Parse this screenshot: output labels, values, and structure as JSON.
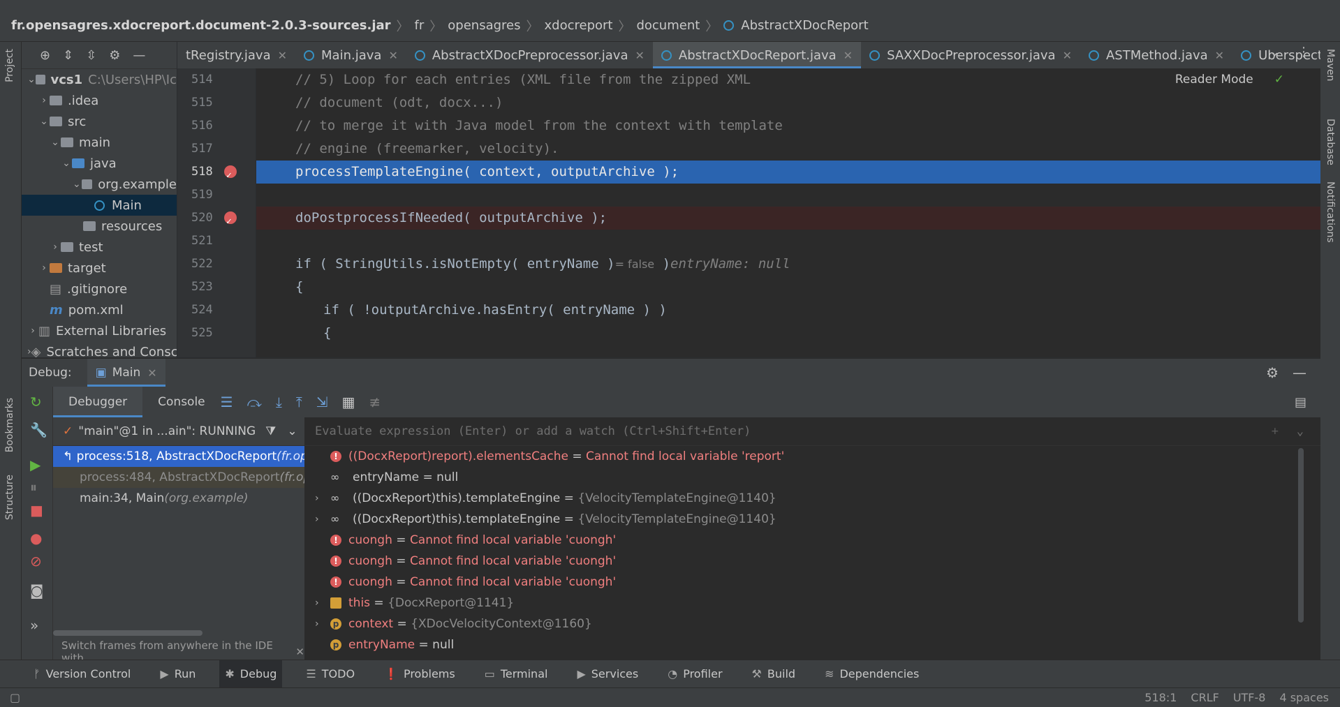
{
  "breadcrumb": {
    "items": [
      "fr.opensagres.xdocreport.document-2.0.3-sources.jar",
      "fr",
      "opensagres",
      "xdocreport",
      "document",
      "AbstractXDocReport"
    ],
    "run_config": "Main"
  },
  "left_stripe": {
    "project": "Project",
    "bookmarks": "Bookmarks",
    "structure": "Structure"
  },
  "right_stripe": {
    "maven": "Maven",
    "database": "Database",
    "notifications": "Notifications"
  },
  "project_tree": [
    {
      "label": "vcs1",
      "extra": "C:\\Users\\HP\\Ic",
      "indent": 0,
      "chev": "⌄",
      "icon": "module"
    },
    {
      "label": ".idea",
      "indent": 1,
      "chev": "›",
      "icon": "folder"
    },
    {
      "label": "src",
      "indent": 1,
      "chev": "⌄",
      "icon": "folder"
    },
    {
      "label": "main",
      "indent": 2,
      "chev": "⌄",
      "icon": "folder"
    },
    {
      "label": "java",
      "indent": 3,
      "chev": "⌄",
      "icon": "folder-blue"
    },
    {
      "label": "org.example",
      "indent": 4,
      "chev": "⌄",
      "icon": "package"
    },
    {
      "label": "Main",
      "indent": 5,
      "chev": "",
      "icon": "class",
      "selected": true
    },
    {
      "label": "resources",
      "indent": 4,
      "chev": "",
      "icon": "folder"
    },
    {
      "label": "test",
      "indent": 2,
      "chev": "›",
      "icon": "folder"
    },
    {
      "label": "target",
      "indent": 1,
      "chev": "›",
      "icon": "folder-orange"
    },
    {
      "label": ".gitignore",
      "indent": 1,
      "chev": "",
      "icon": "file"
    },
    {
      "label": "pom.xml",
      "indent": 1,
      "chev": "",
      "icon": "maven"
    },
    {
      "label": "External Libraries",
      "indent": 0,
      "chev": "›",
      "icon": "libs"
    },
    {
      "label": "Scratches and Consc",
      "indent": 0,
      "chev": "›",
      "icon": "scratch"
    }
  ],
  "tabs": [
    {
      "label": "tRegistry.java",
      "active": false,
      "icon": false
    },
    {
      "label": "Main.java",
      "active": false,
      "icon": true
    },
    {
      "label": "AbstractXDocPreprocessor.java",
      "active": false,
      "icon": true
    },
    {
      "label": "AbstractXDocReport.java",
      "active": true,
      "icon": true
    },
    {
      "label": "SAXXDocPreprocessor.java",
      "active": false,
      "icon": true
    },
    {
      "label": "ASTMethod.java",
      "active": false,
      "icon": true
    },
    {
      "label": "UberspectImpl.j",
      "active": false,
      "icon": true
    }
  ],
  "editor": {
    "reader_mode": "Reader Mode",
    "lines": [
      {
        "n": "514",
        "code": "// 5) Loop for each entries (XML file from the zipped XML",
        "type": "comment",
        "indent": 0
      },
      {
        "n": "515",
        "code": "// document (odt, docx...)",
        "type": "comment",
        "indent": 0
      },
      {
        "n": "516",
        "code": "// to merge it with Java model from the context with template",
        "type": "comment",
        "indent": 0
      },
      {
        "n": "517",
        "code": "// engine (freemarker, velocity).",
        "type": "comment",
        "indent": 0
      },
      {
        "n": "518",
        "code": "processTemplateEngine( context, outputArchive );",
        "type": "highlight",
        "indent": 0,
        "breakpoint": true
      },
      {
        "n": "519",
        "code": "",
        "type": "normal",
        "indent": 0
      },
      {
        "n": "520",
        "code": "doPostprocessIfNeeded( outputArchive );",
        "type": "error",
        "indent": 0,
        "breakpoint": true
      },
      {
        "n": "521",
        "code": "",
        "type": "normal",
        "indent": 0
      },
      {
        "n": "522",
        "code": "if ( StringUtils.isNotEmpty( entryName )",
        "type": "normal",
        "indent": 0,
        "inlay": "= false",
        "tail": " )",
        "inlay2": "entryName: null"
      },
      {
        "n": "523",
        "code": "{",
        "type": "normal",
        "indent": 0
      },
      {
        "n": "524",
        "code": "if ( !outputArchive.hasEntry( entryName ) )",
        "type": "normal",
        "indent": 1
      },
      {
        "n": "525",
        "code": "{",
        "type": "normal",
        "indent": 1
      }
    ]
  },
  "debug": {
    "title": "Debug:",
    "session": "Main",
    "tabs": [
      "Debugger",
      "Console"
    ],
    "thread": "\"main\"@1 in ...ain\": RUNNING",
    "eval_placeholder": "Evaluate expression (Enter) or add a watch (Ctrl+Shift+Enter)",
    "frames": [
      {
        "method": "process:518, AbstractXDocReport",
        "pkg": "(fr.ope",
        "selected": true
      },
      {
        "method": "process:484, AbstractXDocReport",
        "pkg": "(fr.ope",
        "dim": true
      },
      {
        "method": "main:34, Main",
        "pkg": "(org.example)"
      }
    ],
    "hint": "Switch frames from anywhere in the IDE with...",
    "variables": [
      {
        "icon": "err",
        "name": "((DocxReport)report).elementsCache",
        "eq": " = ",
        "value": "Cannot find local variable 'report'",
        "red": true,
        "expand": false
      },
      {
        "icon": "watch",
        "name": "entryName",
        "eq": " = ",
        "value": "null",
        "red": false,
        "expand": false
      },
      {
        "icon": "watch",
        "name": "((DocxReport)this).templateEngine",
        "eq": " = ",
        "value": "{VelocityTemplateEngine@1140}",
        "red": false,
        "obj": true,
        "expand": true
      },
      {
        "icon": "watch",
        "name": "((DocxReport)this).templateEngine",
        "eq": " = ",
        "value": "{VelocityTemplateEngine@1140}",
        "red": false,
        "obj": true,
        "expand": true
      },
      {
        "icon": "err",
        "name": "cuongh",
        "eq": " = ",
        "value": "Cannot find local variable 'cuongh'",
        "red": true,
        "expand": false
      },
      {
        "icon": "err",
        "name": "cuongh",
        "eq": " = ",
        "value": "Cannot find local variable 'cuongh'",
        "red": true,
        "expand": false
      },
      {
        "icon": "err",
        "name": "cuongh",
        "eq": " = ",
        "value": "Cannot find local variable 'cuongh'",
        "red": true,
        "expand": false
      },
      {
        "icon": "list",
        "name": "this",
        "eq": " = ",
        "value": "{DocxReport@1141}",
        "red": false,
        "obj": true,
        "expand": true,
        "namecolor": "red"
      },
      {
        "icon": "p",
        "name": "context",
        "eq": " = ",
        "value": "{XDocVelocityContext@1160}",
        "red": false,
        "obj": true,
        "expand": true,
        "namecolor": "red"
      },
      {
        "icon": "p",
        "name": "entryName",
        "eq": " = ",
        "value": "null",
        "red": false,
        "expand": false,
        "namecolor": "red"
      }
    ]
  },
  "bottom_tools": [
    {
      "label": "Version Control",
      "icon": "ᚠ"
    },
    {
      "label": "Run",
      "icon": "▶"
    },
    {
      "label": "Debug",
      "icon": "✱",
      "active": true
    },
    {
      "label": "TODO",
      "icon": "☰"
    },
    {
      "label": "Problems",
      "icon": "❗"
    },
    {
      "label": "Terminal",
      "icon": "▭"
    },
    {
      "label": "Services",
      "icon": "▶"
    },
    {
      "label": "Profiler",
      "icon": "◔"
    },
    {
      "label": "Build",
      "icon": "⚒"
    },
    {
      "label": "Dependencies",
      "icon": "≋"
    }
  ],
  "status": {
    "position": "518:1",
    "line_sep": "CRLF",
    "encoding": "UTF-8",
    "indent": "4 spaces"
  }
}
